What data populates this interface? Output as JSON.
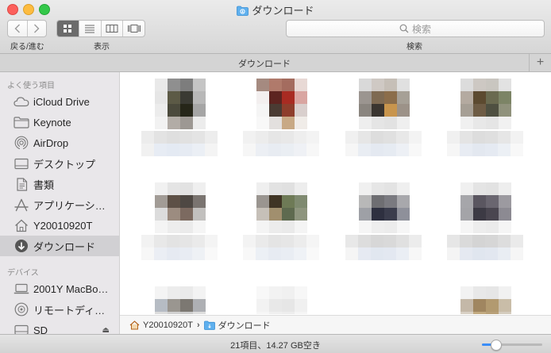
{
  "window": {
    "title": "ダウンロード"
  },
  "toolbar": {
    "nav_label": "戻る/進む",
    "view_label": "表示",
    "search_label": "検索",
    "search_placeholder": "検索",
    "view_modes": [
      "icon",
      "list",
      "column",
      "gallery"
    ],
    "active_view": "icon"
  },
  "tab": {
    "title": "ダウンロード"
  },
  "sidebar": {
    "favorites_header": "よく使う項目",
    "devices_header": "デバイス",
    "favorites": [
      {
        "label": "iCloud Drive",
        "icon": "cloud-icon"
      },
      {
        "label": "Keynote",
        "icon": "folder-icon"
      },
      {
        "label": "AirDrop",
        "icon": "airdrop-icon"
      },
      {
        "label": "デスクトップ",
        "icon": "desktop-icon"
      },
      {
        "label": "書類",
        "icon": "document-icon"
      },
      {
        "label": "アプリケーシ…",
        "icon": "applications-icon"
      },
      {
        "label": "Y20010920T",
        "icon": "home-icon"
      },
      {
        "label": "ダウンロード",
        "icon": "downloads-icon",
        "selected": true
      }
    ],
    "devices": [
      {
        "label": "2001Y MacBo…",
        "icon": "laptop-icon"
      },
      {
        "label": "リモートディ…",
        "icon": "disc-icon"
      },
      {
        "label": "SD",
        "icon": "drive-icon",
        "eject": true
      }
    ]
  },
  "path": {
    "home": "Y20010920T",
    "current": "ダウンロード"
  },
  "status": {
    "text": "21項目、14.27 GB空き",
    "zoom_level": 0.22
  },
  "colors": {
    "accent": "#3b8df7",
    "selection": "#d1d0d3",
    "sidebar_bg": "#e9e7ea"
  }
}
